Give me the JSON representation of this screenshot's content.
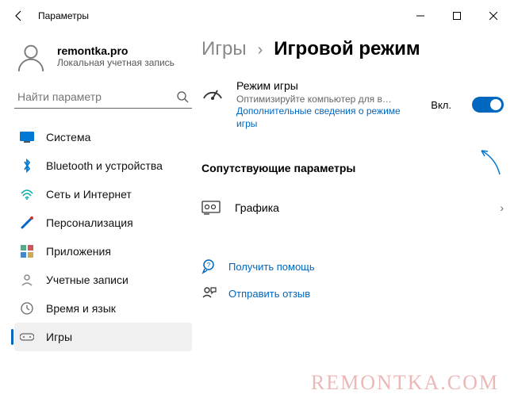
{
  "window": {
    "title": "Параметры"
  },
  "account": {
    "name": "remontka.pro",
    "desc": "Локальная учетная запись"
  },
  "search": {
    "placeholder": "Найти параметр"
  },
  "sidebar": {
    "items": [
      {
        "label": "Система"
      },
      {
        "label": "Bluetooth и устройства"
      },
      {
        "label": "Сеть и Интернет"
      },
      {
        "label": "Персонализация"
      },
      {
        "label": "Приложения"
      },
      {
        "label": "Учетные записи"
      },
      {
        "label": "Время и язык"
      },
      {
        "label": "Игры"
      }
    ]
  },
  "breadcrumb": {
    "parent": "Игры",
    "current": "Игровой режим"
  },
  "gamemode": {
    "title": "Режим игры",
    "desc": "Оптимизируйте компьютер для во...",
    "link": "Дополнительные сведения о режиме игры",
    "toggle_label": "Вкл.",
    "on": true
  },
  "related": {
    "heading": "Сопутствующие параметры",
    "graphics": "Графика"
  },
  "help": {
    "get": "Получить помощь",
    "feedback": "Отправить отзыв"
  },
  "watermark": "REMONTKA.COM"
}
